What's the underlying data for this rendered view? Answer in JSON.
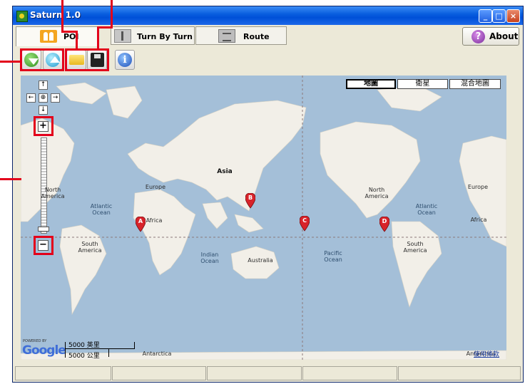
{
  "window": {
    "title": "Saturn 1.0"
  },
  "tabs": [
    {
      "label": "POI",
      "icon": "poi-icon",
      "active": true
    },
    {
      "label": "Turn By Turn",
      "icon": "turn-by-turn-icon"
    },
    {
      "label": "Route",
      "icon": "route-icon"
    }
  ],
  "about_label": "About",
  "toolbar": [
    {
      "name": "move-down-button",
      "icon": "green-down-arrow-icon"
    },
    {
      "name": "move-up-button",
      "icon": "blue-up-arrow-icon"
    },
    {
      "name": "open-button",
      "icon": "folder-icon"
    },
    {
      "name": "save-button",
      "icon": "floppy-disk-icon"
    },
    {
      "name": "info-button",
      "icon": "info-icon"
    }
  ],
  "map": {
    "types": [
      "地圖",
      "衛星",
      "混合地圖"
    ],
    "active_type": "地圖",
    "nav": {
      "up": "↑",
      "left": "←",
      "center": "⊕",
      "right": "→",
      "down": "↓",
      "zoom_in": "+",
      "zoom_out": "−"
    },
    "labels": {
      "asia": "Asia",
      "europe_left": "Europe",
      "europe_right": "Europe",
      "north_america_left": "North America",
      "north_america_right": "North America",
      "africa_left": "Africa",
      "africa_right": "Africa",
      "south_america_left": "South America",
      "south_america_right": "South America",
      "australia": "Australia",
      "antarctica": "Antarctica",
      "antarctica_right": "Antarctica",
      "atlantic_left": "Atlantic Ocean",
      "atlantic_right": "Atlantic Ocean",
      "indian": "Indian Ocean",
      "pacific": "Pacific Ocean"
    },
    "markers": [
      "A",
      "B",
      "C",
      "D"
    ],
    "scale": {
      "miles": "5000 英里",
      "km": "5000 公里"
    },
    "powered_by": "POWERED BY",
    "google": "Google",
    "terms": "使用條款",
    "colors": {
      "water": "#a4bfd8",
      "land": "#f2efe8",
      "marker": "#d8232a",
      "highlight": "#e3001b"
    }
  }
}
